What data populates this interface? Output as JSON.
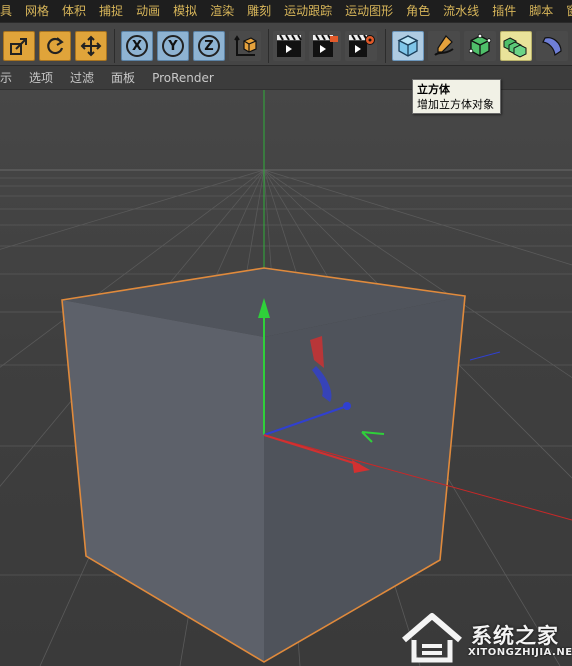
{
  "menu": {
    "items": [
      "具",
      "网格",
      "体积",
      "捕捉",
      "动画",
      "模拟",
      "渲染",
      "雕刻",
      "运动跟踪",
      "运动图形",
      "角色",
      "流水线",
      "插件",
      "脚本",
      "窗口"
    ]
  },
  "toolbar": {
    "x_label": "X",
    "y_label": "Y",
    "z_label": "Z",
    "icons": [
      "scale-icon",
      "rotate-icon",
      "move-icon",
      "x-axis-icon",
      "y-axis-icon",
      "z-axis-icon",
      "coordinate-system-icon",
      "render-view-icon",
      "render-picture-viewer-icon",
      "render-settings-icon",
      "cube-icon",
      "pen-icon",
      "subdivision-icon",
      "cloner-icon",
      "deformer-icon"
    ]
  },
  "viewport_menu": {
    "items": [
      "示",
      "选项",
      "过滤",
      "面板",
      "ProRender"
    ]
  },
  "tooltip": {
    "title": "立方体",
    "description": "增加立方体对象"
  },
  "watermark": {
    "name": "系统之家",
    "url": "XITONGZHIJIA.NET"
  },
  "colors": {
    "menu_text": "#d8b65a",
    "menu_bg": "#1e1e1e",
    "toolbar_bg": "#454545",
    "selection_outline": "#e08a3c",
    "axis_x": "#d23030",
    "axis_y": "#30c030",
    "axis_z": "#3040d0"
  }
}
